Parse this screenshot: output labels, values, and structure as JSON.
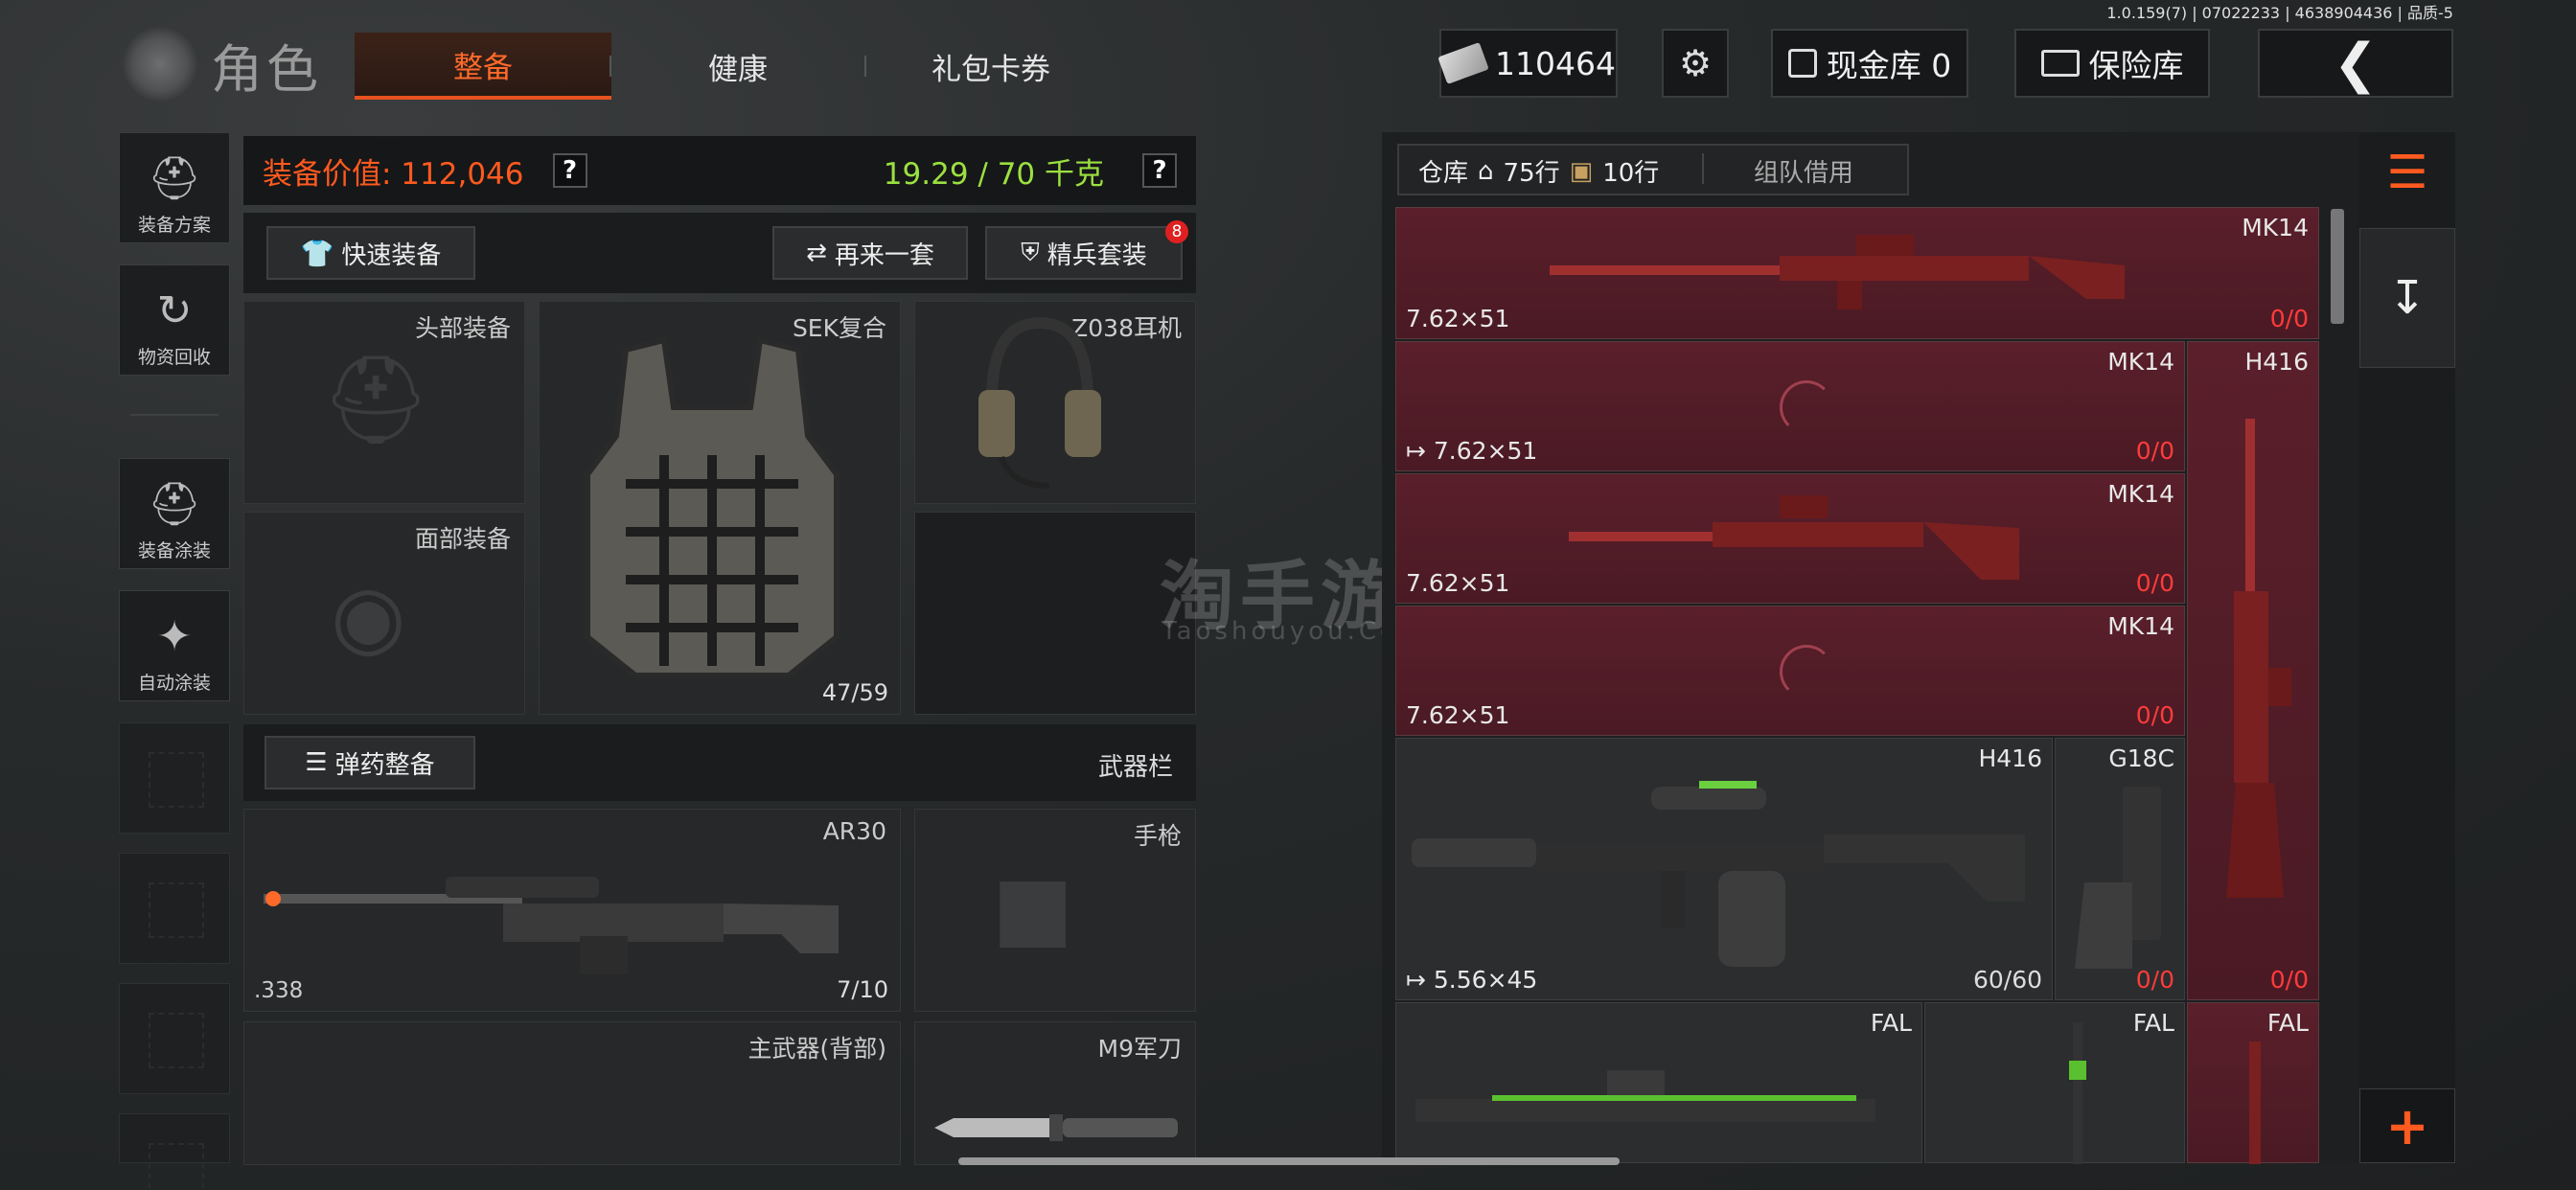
{
  "version_text": "1.0.159(7) | 07022233 | 4638904436 | 品质-5",
  "header": {
    "title": "角色",
    "tabs": [
      {
        "label": "整备"
      },
      {
        "label": "健康"
      },
      {
        "label": "礼包卡券"
      }
    ],
    "money": "110464",
    "cash_vault_label": "现金库 0",
    "insurance_label": "保险库"
  },
  "sidebar": {
    "items": [
      {
        "label": "装备方案",
        "icon": "loadout-icon"
      },
      {
        "label": "物资回收",
        "icon": "recycle-icon"
      },
      {
        "label": "装备涂装",
        "icon": "paint-icon"
      },
      {
        "label": "自动涂装",
        "icon": "auto-paint-icon"
      }
    ]
  },
  "equipment": {
    "value_label": "装备价值: 112,046",
    "weight_label": "19.29 / 70 千克",
    "quick_equip": "快速装备",
    "again_set": "再来一套",
    "elite_set": "精兵套装",
    "elite_badge": "8",
    "slots": {
      "head": "头部装备",
      "face": "面部装备",
      "armor_name": "SEK复合",
      "armor_durability": "47/59",
      "headset": "Z038耳机"
    },
    "ammo_button": "弹药整备",
    "weapon_bar": "武器栏",
    "primary_name": "AR30",
    "primary_caliber": ".338",
    "primary_ammo": "7/10",
    "pistol": "手枪",
    "primary_back": "主武器(背部)",
    "melee": "M9军刀"
  },
  "warehouse": {
    "tab_label": "仓库",
    "rows1": "75行",
    "rows2": "10行",
    "team_borrow": "组队借用",
    "items": [
      {
        "name": "MK14",
        "caliber": "7.62×51",
        "count_a": "0",
        "count_b": "/0"
      },
      {
        "name": "MK14",
        "caliber": "7.62×51",
        "count_a": "0",
        "count_b": "/0"
      },
      {
        "name": "H416",
        "caliber": "",
        "count_a": "0",
        "count_b": "/0"
      },
      {
        "name": "MK14",
        "caliber": "7.62×51",
        "count_a": "0",
        "count_b": "/0"
      },
      {
        "name": "MK14",
        "caliber": "7.62×51",
        "count_a": "0",
        "count_b": "/0"
      },
      {
        "name": "H416",
        "caliber": "5.56×45",
        "count": "60/60"
      },
      {
        "name": "G18C",
        "count_a": "0",
        "count_b": "/0"
      },
      {
        "name": "FAL"
      },
      {
        "name": "FAL"
      },
      {
        "name": "FAL"
      }
    ]
  },
  "watermark": {
    "cn": "淘手游",
    "en": "Taoshouyou.Com"
  }
}
